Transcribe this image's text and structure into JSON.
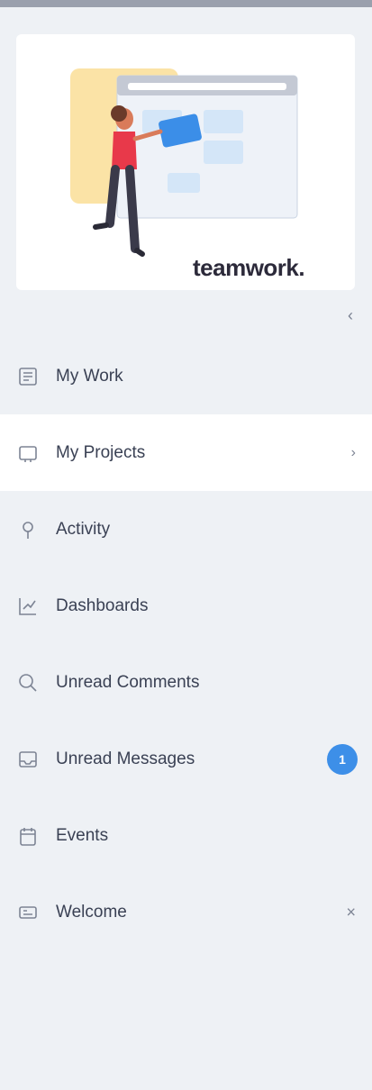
{
  "banner": {
    "brand": "teamwork."
  },
  "sidebar": {
    "collapse_icon": "chevron-left-icon",
    "items": [
      {
        "label": "My Work",
        "icon": "my-work-icon"
      },
      {
        "label": "My Projects",
        "icon": "folder-icon",
        "active": true,
        "chevron": "›"
      },
      {
        "label": "Activity",
        "icon": "pin-icon"
      },
      {
        "label": "Dashboards",
        "icon": "dashboard-icon"
      },
      {
        "label": "Unread Comments",
        "icon": "comments-icon"
      },
      {
        "label": "Unread Messages",
        "icon": "inbox-icon",
        "badge": "1"
      },
      {
        "label": "Events",
        "icon": "calendar-icon"
      },
      {
        "label": "Welcome",
        "icon": "welcome-icon",
        "close": "×"
      }
    ]
  },
  "colors": {
    "background": "#eef1f5",
    "active_item": "#ffffff",
    "badge": "#3d8fe8"
  }
}
